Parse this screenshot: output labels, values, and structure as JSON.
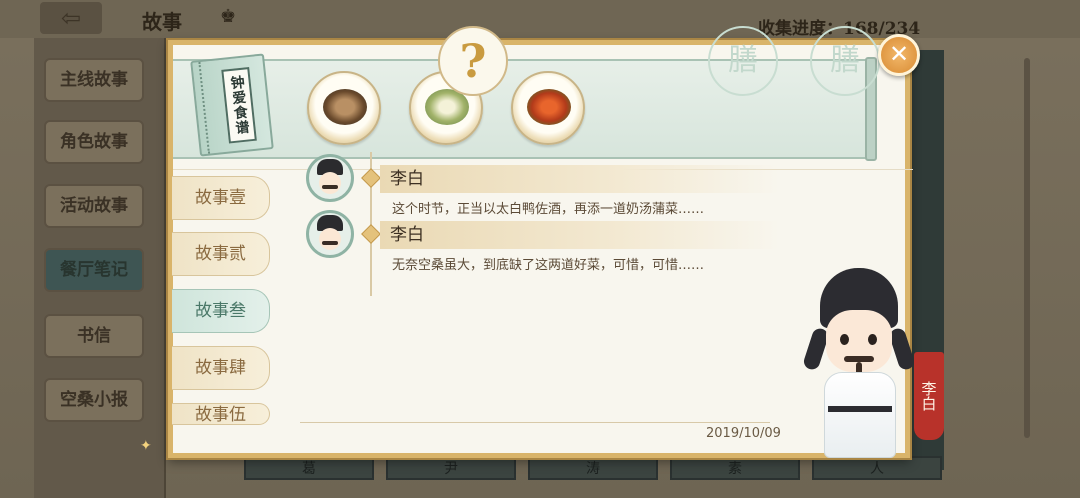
{
  "background": {
    "title": "故事",
    "collection_progress": "收集进度：168/234",
    "side_tabs": [
      "主线故事",
      "角色故事",
      "活动故事",
      "餐厅笔记",
      "书信",
      "空桑小报"
    ],
    "active_side_tab_index": 3,
    "bottom_cells": [
      "葛",
      "尹",
      "涛",
      "素",
      "人"
    ]
  },
  "dialog": {
    "book_title": "钟爱食谱",
    "dishes": [
      {
        "name": "soup-dish",
        "state": "collected"
      },
      {
        "name": "vegetable-dish",
        "state": "collected"
      },
      {
        "name": "roast-duck-dish",
        "state": "collected"
      },
      {
        "name": "unknown-dish",
        "state": "unknown",
        "glyph": "?"
      },
      {
        "name": "locked-dish",
        "state": "locked",
        "glyph": "膳"
      },
      {
        "name": "locked-dish",
        "state": "locked",
        "glyph": "膳"
      }
    ],
    "chapters": [
      "故事壹",
      "故事贰",
      "故事叁",
      "故事肆",
      "故事伍"
    ],
    "active_chapter_index": 2,
    "lines": [
      {
        "speaker": "李白",
        "text": "这个时节，正当以太白鸭佐酒，再添一道奶汤蒲菜……"
      },
      {
        "speaker": "李白",
        "text": "无奈空桑虽大，到底缺了这两道好菜，可惜，可惜……"
      }
    ],
    "date": "2019/10/09",
    "character_name": "李白",
    "close_label": "✕"
  },
  "colors": {
    "frame_gold": "#d9b46a",
    "accent_green": "#4a7868",
    "name_tag_red": "#b8322a"
  }
}
